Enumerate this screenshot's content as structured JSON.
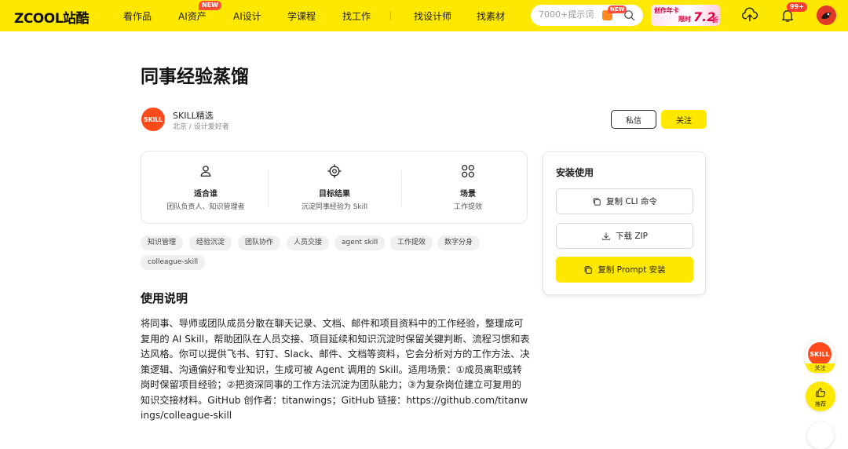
{
  "nav": {
    "logo": "ZCOOL站酷",
    "items": [
      {
        "label": "看作品"
      },
      {
        "label": "AI资产",
        "badge": "NEW"
      },
      {
        "label": "AI设计"
      },
      {
        "label": "学课程"
      },
      {
        "label": "找工作"
      },
      {
        "label": "找设计师"
      },
      {
        "label": "找素材"
      }
    ],
    "search_placeholder": "7000+提示词",
    "search_badge": "NEW",
    "promo": {
      "top": "创作年卡",
      "bottom": "限时",
      "price": "7.2",
      "unit": "折"
    },
    "notification_count": "99+"
  },
  "page": {
    "title": "同事经验蒸馏"
  },
  "author": {
    "avatar_text": "SKILL",
    "name": "SKILL精选",
    "meta": "北京 / 设计爱好者",
    "message_label": "私信",
    "follow_label": "关注"
  },
  "info": [
    {
      "icon": "user-icon",
      "title": "适合谁",
      "subtitle": "团队负责人、知识管理者"
    },
    {
      "icon": "target-icon",
      "title": "目标结果",
      "subtitle": "沉淀同事经验为 Skill"
    },
    {
      "icon": "grid-icon",
      "title": "场景",
      "subtitle": "工作提效"
    }
  ],
  "tags": [
    "知识管理",
    "经验沉淀",
    "团队协作",
    "人员交接",
    "agent skill",
    "工作提效",
    "数字分身",
    "colleague-skill"
  ],
  "usage": {
    "title": "使用说明",
    "description": "将同事、导师或团队成员分散在聊天记录、文档、邮件和项目资料中的工作经验，整理成可复用的 AI Skill，帮助团队在人员交接、项目延续和知识沉淀时保留关键判断、流程习惯和表达风格。你可以提供飞书、钉钉、Slack、邮件、文档等资料，它会分析对方的工作方法、决策逻辑、沟通偏好和专业知识，生成可被 Agent 调用的 Skill。适用场景：①成员离职或转岗时保留项目经验；②把资深同事的工作方法沉淀为团队能力；③为复杂岗位建立可复用的知识交接材料。GitHub 创作者：titanwings；GitHub 链接：https://github.com/titanwings/colleague-skill"
  },
  "install": {
    "title": "安装使用",
    "copy_cli_label": "复制 CLI 命令",
    "download_zip_label": "下载 ZIP",
    "copy_prompt_label": "复制 Prompt 安装"
  },
  "floating": {
    "skill_avatar_text": "SKILL",
    "skill_label": "关注",
    "recommend_label": "推荐"
  },
  "colors": {
    "brand_yellow": "#ffe800",
    "badge_red": "#ff4f3c",
    "skill_orange": "#ff4a1c"
  }
}
